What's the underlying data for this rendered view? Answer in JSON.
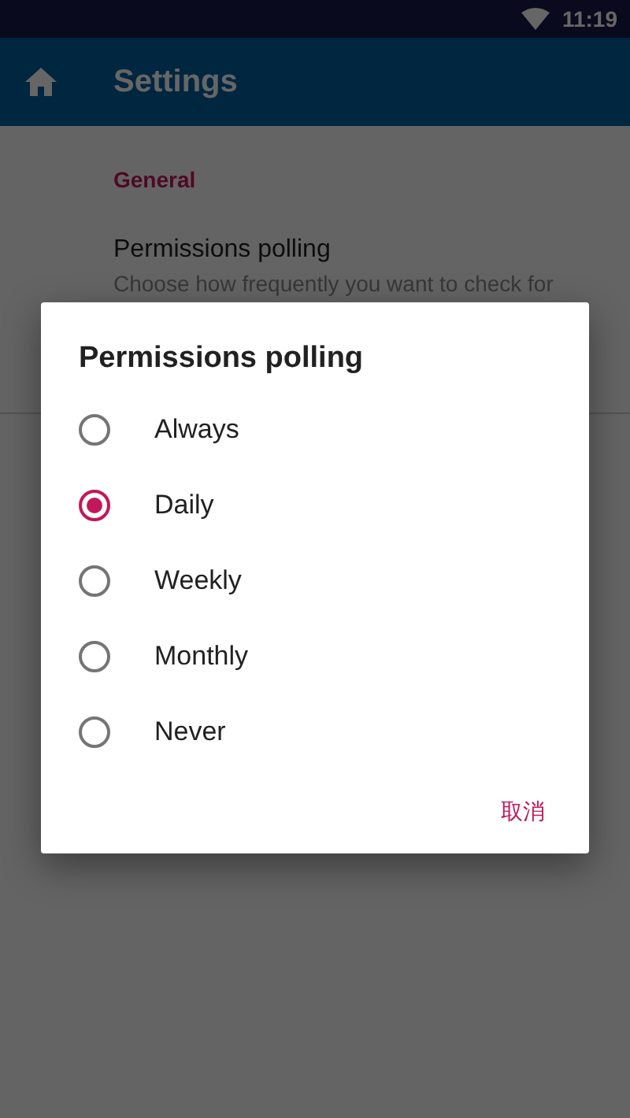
{
  "status_bar": {
    "time": "11:19"
  },
  "toolbar": {
    "title": "Settings"
  },
  "settings": {
    "category": "General",
    "item": {
      "title": "Permissions polling",
      "summary": "Choose how frequently you want to check for"
    }
  },
  "dialog": {
    "title": "Permissions polling",
    "options": [
      {
        "label": "Always",
        "selected": false
      },
      {
        "label": "Daily",
        "selected": true
      },
      {
        "label": "Weekly",
        "selected": false
      },
      {
        "label": "Monthly",
        "selected": false
      },
      {
        "label": "Never",
        "selected": false
      }
    ],
    "cancel": "取消"
  }
}
